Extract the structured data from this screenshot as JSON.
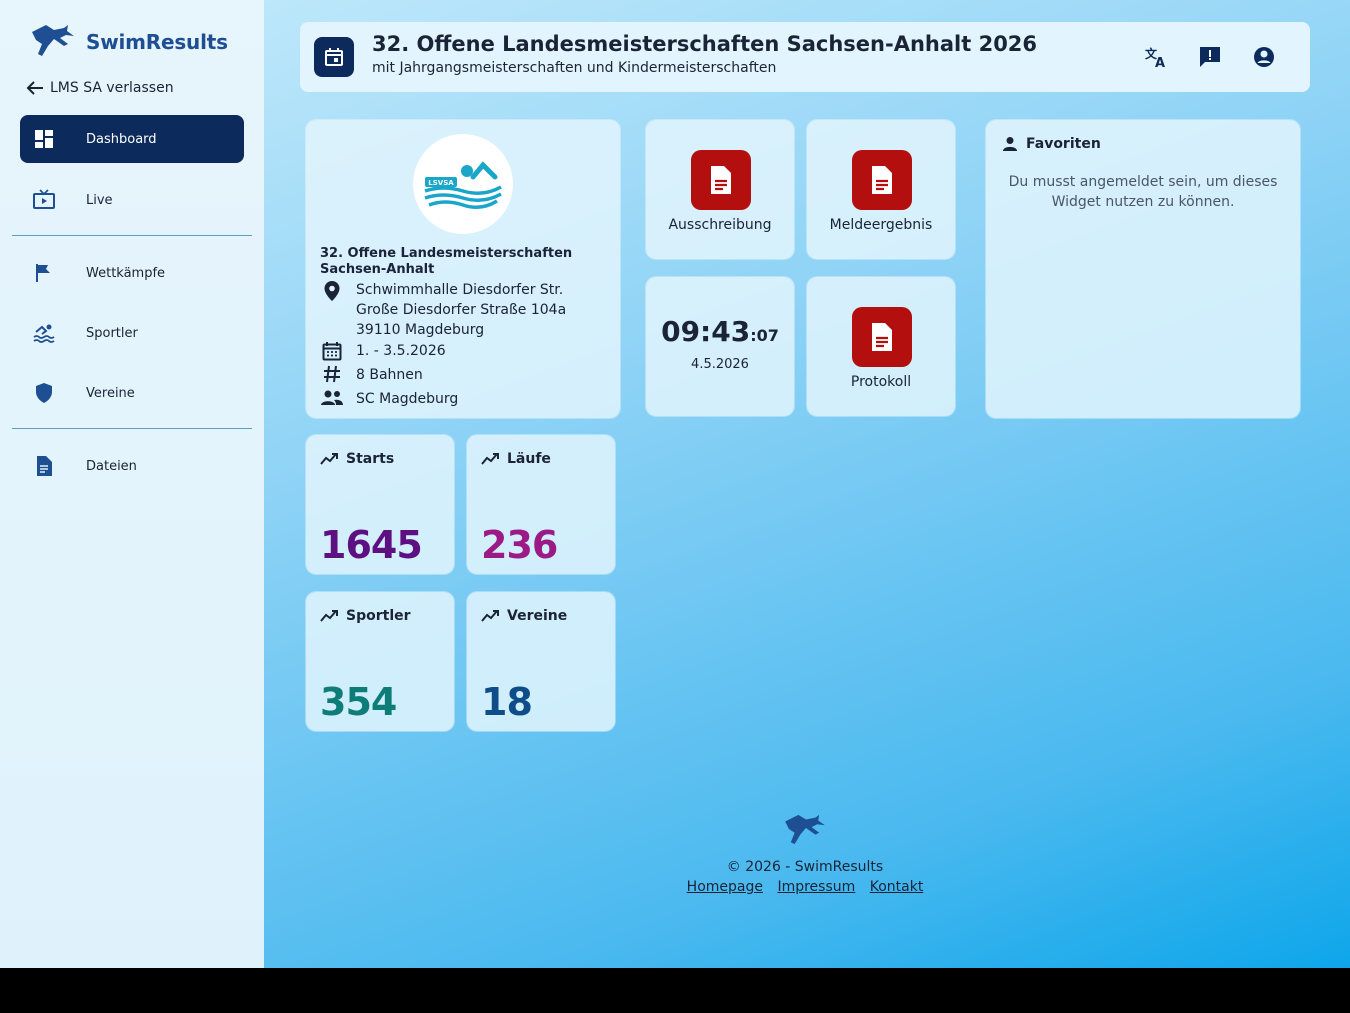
{
  "brand": {
    "name": "SwimResults"
  },
  "sidebar": {
    "back_label": "LMS SA verlassen",
    "items": [
      {
        "label": "Dashboard",
        "icon": "dashboard-icon",
        "active": true
      },
      {
        "label": "Live",
        "icon": "live-tv-icon"
      },
      {
        "label": "Wettkämpfe",
        "icon": "flag-icon"
      },
      {
        "label": "Sportler",
        "icon": "swimmer-icon"
      },
      {
        "label": "Vereine",
        "icon": "shield-icon"
      },
      {
        "label": "Dateien",
        "icon": "document-icon"
      }
    ]
  },
  "header": {
    "title": "32. Offene Landesmeisterschaften Sachsen-Anhalt 2026",
    "subtitle": "mit Jahrgangsmeisterschaften und Kindermeisterschaften",
    "buttons": [
      "translate-icon",
      "feedback-icon",
      "account-icon"
    ]
  },
  "event": {
    "logo_text": "LSVSA",
    "name": "32. Offene Landesmeisterschaften Sachsen-Anhalt",
    "venue_line1": "Schwimmhalle Diesdorfer Str.",
    "venue_line2": "Große Diesdorfer Straße 104a",
    "venue_line3": "39110 Magdeburg",
    "dates": "1. - 3.5.2026",
    "lanes": "8 Bahnen",
    "organizer": "SC Magdeburg"
  },
  "documents": [
    {
      "label": "Ausschreibung"
    },
    {
      "label": "Meldeergebnis"
    },
    {
      "label": "Protokoll"
    }
  ],
  "clock": {
    "time": "09:43",
    "seconds": ":07",
    "date": "4.5.2026"
  },
  "favorites": {
    "title": "Favoriten",
    "message": "Du musst angemeldet sein, um dieses Widget nutzen zu können."
  },
  "stats": [
    {
      "label": "Starts",
      "value": "1645",
      "color": "#5d1081"
    },
    {
      "label": "Läufe",
      "value": "236",
      "color": "#9b1a86"
    },
    {
      "label": "Sportler",
      "value": "354",
      "color": "#0e7d77"
    },
    {
      "label": "Vereine",
      "value": "18",
      "color": "#0e4d8a"
    }
  ],
  "footer": {
    "copyright": "© 2026 - SwimResults",
    "links": [
      "Homepage",
      "Impressum",
      "Kontakt"
    ]
  },
  "colors": {
    "primary": "#0c2a5b",
    "doc_red": "#b30f0f",
    "brand_blue": "#1e4f92"
  }
}
